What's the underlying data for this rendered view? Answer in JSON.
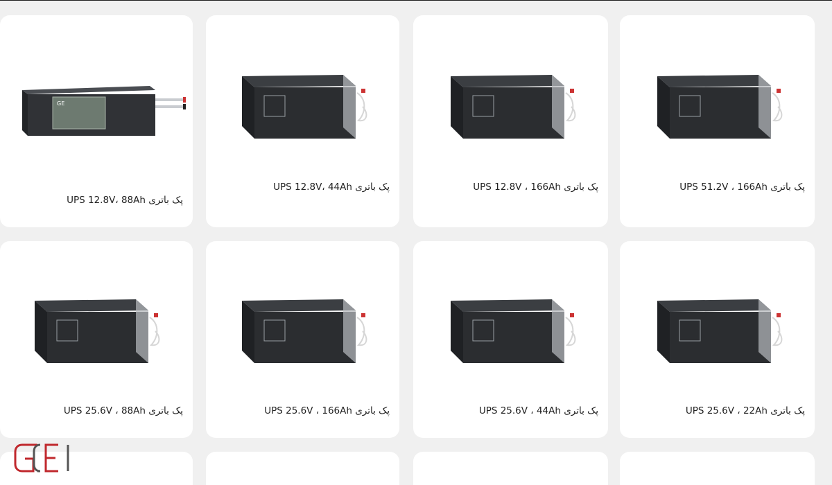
{
  "products": [
    {
      "title": "پک باتری UPS 51.2V ، 166Ah"
    },
    {
      "title": "پک باتری UPS 12.8V ، 166Ah"
    },
    {
      "title": "پک باتری UPS 12.8V، 44Ah"
    },
    {
      "title": "پک باتری UPS 12.8V، 88Ah"
    },
    {
      "title": "پک باتری UPS 25.6V ، 22Ah"
    },
    {
      "title": "پک باتری UPS 25.6V ، 44Ah"
    },
    {
      "title": "پک باتری UPS 25.6V ، 166Ah"
    },
    {
      "title": "پک باتری UPS 25.6V ، 88Ah"
    }
  ],
  "logo": {
    "text": "GEI",
    "color": "#c0282d"
  },
  "colors": {
    "background": "#f0f0f0",
    "card": "#ffffff",
    "battery_body": "#2b2d30",
    "battery_top": "#3b3e42",
    "battery_end": "#b9bcc0"
  }
}
